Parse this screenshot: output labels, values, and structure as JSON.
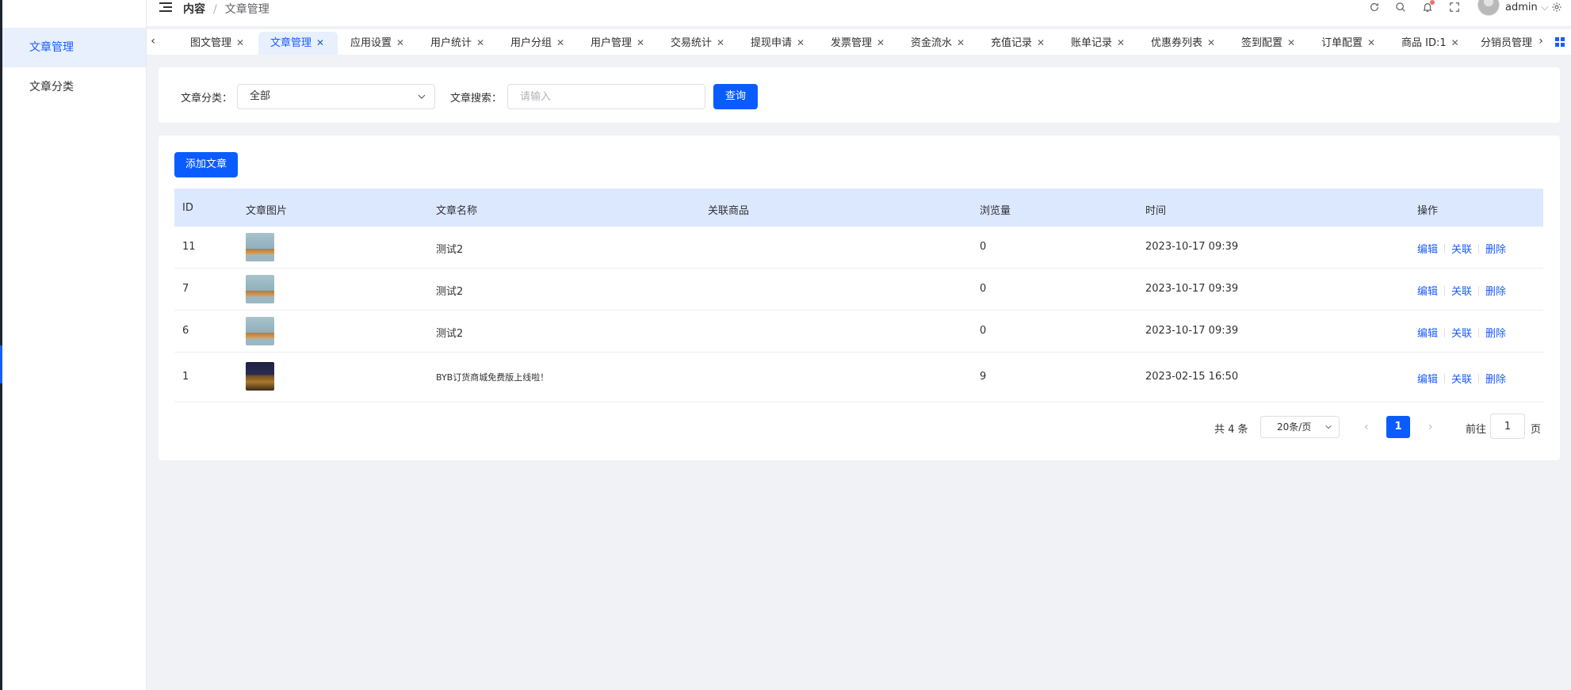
{
  "sidebar": {
    "items": [
      {
        "label": "文章管理",
        "active": true
      },
      {
        "label": "文章分类",
        "active": false
      }
    ]
  },
  "header": {
    "breadcrumb": [
      "内容",
      "文章管理"
    ],
    "user": "admin"
  },
  "tabs": [
    {
      "label": "图文管理",
      "active": false
    },
    {
      "label": "文章管理",
      "active": true
    },
    {
      "label": "应用设置",
      "active": false
    },
    {
      "label": "用户统计",
      "active": false
    },
    {
      "label": "用户分组",
      "active": false
    },
    {
      "label": "用户管理",
      "active": false
    },
    {
      "label": "交易统计",
      "active": false
    },
    {
      "label": "提现申请",
      "active": false
    },
    {
      "label": "发票管理",
      "active": false
    },
    {
      "label": "资金流水",
      "active": false
    },
    {
      "label": "充值记录",
      "active": false
    },
    {
      "label": "账单记录",
      "active": false
    },
    {
      "label": "优惠券列表",
      "active": false
    },
    {
      "label": "签到配置",
      "active": false
    },
    {
      "label": "订单配置",
      "active": false
    },
    {
      "label": "商品 ID:1",
      "active": false
    },
    {
      "label": "分销员管理",
      "active": false
    }
  ],
  "filter": {
    "category_label": "文章分类：",
    "category_value": "全部",
    "search_label": "文章搜索：",
    "search_placeholder": "请输入",
    "search_value": "",
    "query_button": "查询"
  },
  "toolbar": {
    "add_button": "添加文章"
  },
  "table": {
    "columns": [
      "ID",
      "文章图片",
      "文章名称",
      "关联商品",
      "浏览量",
      "时间",
      "操作"
    ],
    "rows": [
      {
        "id": "11",
        "image": "thumbnail-hands",
        "name": "测试2",
        "product": "",
        "views": "0",
        "time": "2023-10-17 09:39"
      },
      {
        "id": "7",
        "image": "thumbnail-hands",
        "name": "测试2",
        "product": "",
        "views": "0",
        "time": "2023-10-17 09:39"
      },
      {
        "id": "6",
        "image": "thumbnail-hands",
        "name": "测试2",
        "product": "",
        "views": "0",
        "time": "2023-10-17 09:39"
      },
      {
        "id": "1",
        "image": "thumbnail-banner",
        "name": "BYB订货商城免费版上线啦！",
        "product": "",
        "views": "9",
        "time": "2023-02-15 16:50"
      }
    ],
    "actions": [
      "编辑",
      "关联",
      "删除"
    ]
  },
  "pagination": {
    "total_text": "共 4 条",
    "page_size": "20条/页",
    "current_page": "1",
    "goto_label": "前往",
    "goto_value": "1",
    "page_unit": "页"
  },
  "colors": {
    "primary": "#0b5cff",
    "active_tab_bg": "#e8f0fe",
    "table_header_bg": "#dce8fe",
    "page_bg": "#f0f2f5"
  }
}
